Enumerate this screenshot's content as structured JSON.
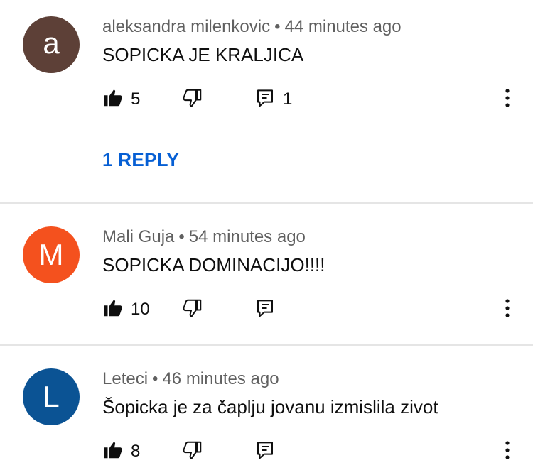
{
  "comments": [
    {
      "author": "aleksandra milenkovic",
      "time": "44 minutes ago",
      "text": "SOPICKA JE KRALJICA",
      "avatar_letter": "a",
      "avatar_color": "#5d4037",
      "likes": "5",
      "replies_count": "1",
      "reply_link": "1 REPLY"
    },
    {
      "author": "Mali Guja",
      "time": "54 minutes ago",
      "text": "SOPICKA DOMINACIJO!!!!",
      "avatar_letter": "M",
      "avatar_color": "#f4511e",
      "likes": "10"
    },
    {
      "author": "Leteci",
      "time": "46 minutes ago",
      "text": "Šopicka je za čaplju jovanu izmislila zivot",
      "avatar_letter": "L",
      "avatar_color": "#0b5394",
      "likes": "8"
    }
  ],
  "meta_separator": "•",
  "icons": {
    "like": "thumbs-up-icon",
    "dislike": "thumbs-down-icon",
    "reply": "comment-icon",
    "more": "more-vertical-icon"
  },
  "colors": {
    "link": "#065fd4",
    "meta": "#606060",
    "divider": "#e5e5e5"
  }
}
